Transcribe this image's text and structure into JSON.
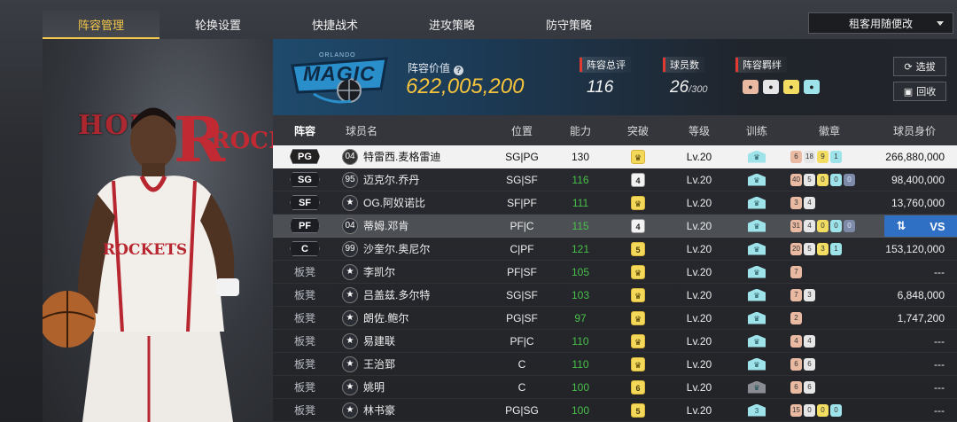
{
  "tabs": [
    {
      "label": "阵容管理",
      "active": true
    },
    {
      "label": "轮换设置",
      "active": false
    },
    {
      "label": "快捷战术",
      "active": false
    },
    {
      "label": "进攻策略",
      "active": false
    },
    {
      "label": "防守策略",
      "active": false
    }
  ],
  "mode_select": {
    "value": "租客用随便改"
  },
  "art": {
    "team_text_left": "HOU",
    "team_letter": "R",
    "team_text_right": "ROCK",
    "jersey": "ROCKETS"
  },
  "team": {
    "logo_text": "MAGIC",
    "logo_city": "ORLANDO",
    "value_label": "阵容价值",
    "value": "622,005,200",
    "overall_label": "阵容总评",
    "overall": "116",
    "players_label": "球员数",
    "players": "26",
    "players_max": "/300",
    "fetters_label": "阵容羁绊",
    "fetters": [
      "fetter-1",
      "fetter-2",
      "fetter-3",
      "fetter-4"
    ]
  },
  "buttons": {
    "select": "选拔",
    "recycle": "回收",
    "vs": "VS"
  },
  "columns": {
    "pos": "阵容",
    "name": "球员名",
    "role": "位置",
    "ability": "能力",
    "breakthrough": "突破",
    "level": "等级",
    "training": "训练",
    "badges": "徽章",
    "price": "球员身价"
  },
  "rows": [
    {
      "pos": "PG",
      "num": "04",
      "name": "特雷西.麦格雷迪",
      "role": "SG|PG",
      "ability": "130",
      "brk": "",
      "level": "Lv.20",
      "badges": [
        "6",
        "18",
        "9",
        "1"
      ],
      "price": "266,880,000"
    },
    {
      "pos": "SG",
      "num": "95",
      "name": "迈克尔.乔丹",
      "role": "SG|SF",
      "ability": "116",
      "brk": "4",
      "level": "Lv.20",
      "badges": [
        "40",
        "5",
        "0",
        "0",
        "0"
      ],
      "price": "98,400,000"
    },
    {
      "pos": "SF",
      "num": "",
      "name": "OG.阿奴诺比",
      "role": "SF|PF",
      "ability": "111",
      "brk": "",
      "level": "Lv.20",
      "badges": [
        "3",
        "4"
      ],
      "price": "13,760,000"
    },
    {
      "pos": "PF",
      "num": "04",
      "name": "蒂姆.邓肯",
      "role": "PF|C",
      "ability": "115",
      "brk": "4",
      "level": "Lv.20",
      "badges": [
        "31",
        "4",
        "0",
        "0",
        "0"
      ],
      "price": ""
    },
    {
      "pos": "C",
      "num": "99",
      "name": "沙奎尔.奥尼尔",
      "role": "C|PF",
      "ability": "121",
      "brk": "5",
      "level": "Lv.20",
      "badges": [
        "20",
        "5",
        "3",
        "1"
      ],
      "price": "153,120,000"
    },
    {
      "pos": "板凳",
      "num": "",
      "name": "李凯尔",
      "role": "PF|SF",
      "ability": "105",
      "brk": "",
      "level": "Lv.20",
      "badges": [
        "7"
      ],
      "price": "---"
    },
    {
      "pos": "板凳",
      "num": "",
      "name": "吕盖兹.多尔特",
      "role": "SG|SF",
      "ability": "103",
      "brk": "",
      "level": "Lv.20",
      "badges": [
        "7",
        "3"
      ],
      "price": "6,848,000"
    },
    {
      "pos": "板凳",
      "num": "",
      "name": "朗佐.鲍尔",
      "role": "PG|SF",
      "ability": "97",
      "brk": "",
      "level": "Lv.20",
      "badges": [
        "2"
      ],
      "price": "1,747,200"
    },
    {
      "pos": "板凳",
      "num": "",
      "name": "易建联",
      "role": "PF|C",
      "ability": "110",
      "brk": "",
      "level": "Lv.20",
      "badges": [
        "4",
        "4"
      ],
      "price": "---"
    },
    {
      "pos": "板凳",
      "num": "",
      "name": "王治郅",
      "role": "C",
      "ability": "110",
      "brk": "",
      "level": "Lv.20",
      "badges": [
        "6",
        "6"
      ],
      "price": "---"
    },
    {
      "pos": "板凳",
      "num": "",
      "name": "姚明",
      "role": "C",
      "ability": "100",
      "brk": "6",
      "level": "Lv.20",
      "badges": [
        "6",
        "6"
      ],
      "price": "---"
    },
    {
      "pos": "板凳",
      "num": "",
      "name": "林书豪",
      "role": "PG|SG",
      "ability": "100",
      "brk": "5",
      "level": "Lv.20",
      "badges": [
        "15",
        "0",
        "0",
        "0"
      ],
      "price": "---"
    }
  ]
}
